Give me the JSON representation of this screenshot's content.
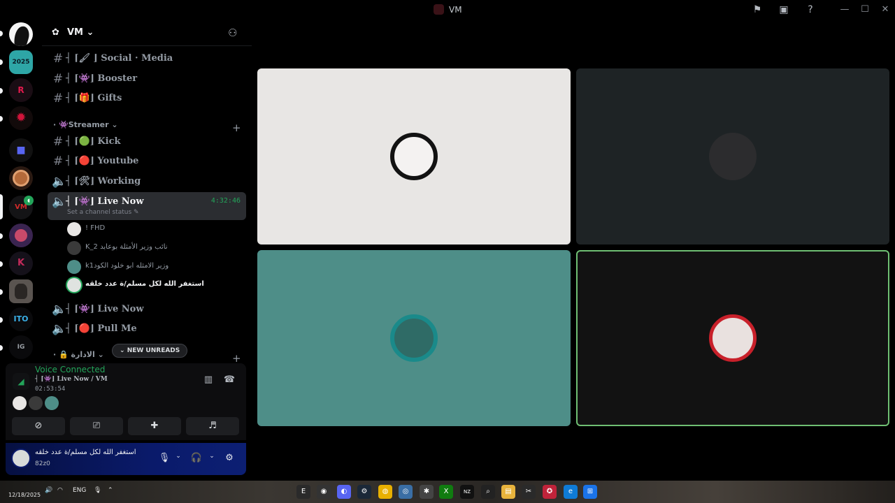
{
  "window": {
    "title": "VM"
  },
  "server": {
    "name": "VM"
  },
  "channels": [
    {
      "kind": "text",
      "label": "┤ ⌈🖌 ⌋ Social · Media"
    },
    {
      "kind": "text",
      "label": "┤ ⌈👾⌋ Booster"
    },
    {
      "kind": "text",
      "label": "┤ ⌈🎁⌋ Gifts"
    },
    {
      "kind": "text",
      "label": "┤ ⌈🟢⌋ Kick"
    },
    {
      "kind": "text",
      "label": "┤ ⌈🔴⌋ Youtube"
    },
    {
      "kind": "voice",
      "label": "┤ ⌈🛠⌋ Working"
    },
    {
      "kind": "voice",
      "label": "┤ ⌈👾⌋ Live Now",
      "timer": "4:32:46",
      "status": "Set a channel status"
    },
    {
      "kind": "voice",
      "label": "┤ ⌈👾⌋ Live Now"
    },
    {
      "kind": "voice",
      "label": "┤ ⌈🔴⌋ Pull Me"
    }
  ],
  "categories": {
    "streamer": "👾Streamer",
    "admin": "الادارة"
  },
  "voice_users": [
    {
      "name": "! FHD",
      "color": "#e8e6e4"
    },
    {
      "name": "K_2 نائب وزير الأمثلة بوعابد",
      "color": "#3a3a3a"
    },
    {
      "name": "k1وزير الامثله ابو خلود الكود",
      "color": "#4e8e88"
    },
    {
      "name": "استغفر الله لكل مسلم/ة عدد خلقه",
      "color": "#dfe3e0"
    }
  ],
  "new_unreads": "NEW UNREADS",
  "voice_panel": {
    "connected": "Voice Connected",
    "channel_path": "┤ ⌈👾⌋ Live Now / VM",
    "elapsed": "02:53:54",
    "participant_colors": [
      "#e8e6e4",
      "#3a3a3a",
      "#4e8e88"
    ]
  },
  "user": {
    "name": "استغفر الله لكل مسلم/ة عدد خلقه",
    "tag": "82z0"
  },
  "stage_tiles": [
    {
      "bg": "#e8e6e4",
      "pfp": "#f4f2f1"
    },
    {
      "bg": "#1e2325",
      "pfp": "#2c2c2e"
    },
    {
      "bg": "#4e8e88",
      "pfp": "#2f6b66"
    },
    {
      "bg": "#121212",
      "pfp": "#e9e1df"
    }
  ],
  "taskbar": {
    "date": "12/18/2025",
    "lang": "ENG"
  },
  "accent": "#23a55a"
}
